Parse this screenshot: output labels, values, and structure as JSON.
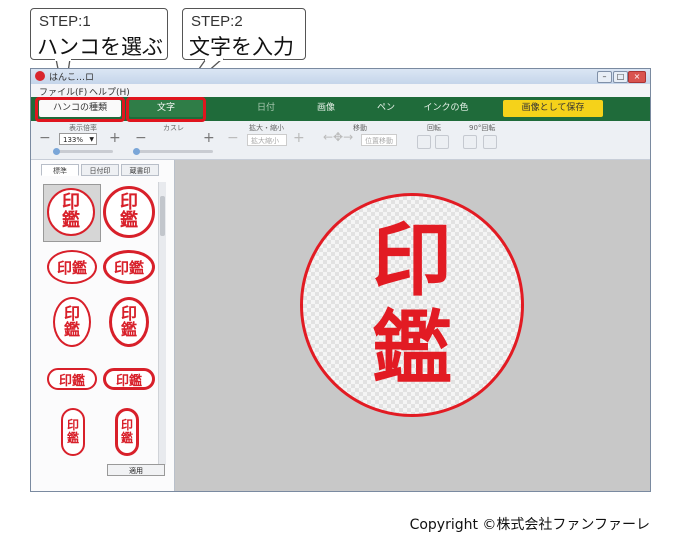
{
  "callouts": [
    {
      "step": "STEP:1",
      "title": "ハンコを選ぶ"
    },
    {
      "step": "STEP:2",
      "title": "文字を入力"
    }
  ],
  "window": {
    "title": "はんこ…ロ",
    "menu": [
      "ファイル(F)",
      "ヘルプ(H)"
    ]
  },
  "tabs": [
    "ハンコの種類",
    "文字",
    "日付",
    "画像",
    "ペン",
    "インクの色",
    "画像として保存"
  ],
  "toolbar": {
    "labels": [
      "表示倍率",
      "カスレ",
      "拡大・縮小",
      "移動",
      "回転",
      "90°回転"
    ],
    "zoom_value": "133%",
    "resize_placeholder": "拡大縮小",
    "move_placeholder": "位置移動"
  },
  "panel_tabs": [
    "標準",
    "日付印",
    "蔵書印"
  ],
  "stamp_text": "印鑑",
  "stamp_chars": [
    "印",
    "鑑"
  ],
  "apply_label": "適用",
  "copyright": "Copyright ©株式会社ファンファーレ",
  "colors": {
    "accent_red": "#e21b23",
    "toolbar_green": "#1f6b3a",
    "save_yellow": "#f5d21a"
  }
}
